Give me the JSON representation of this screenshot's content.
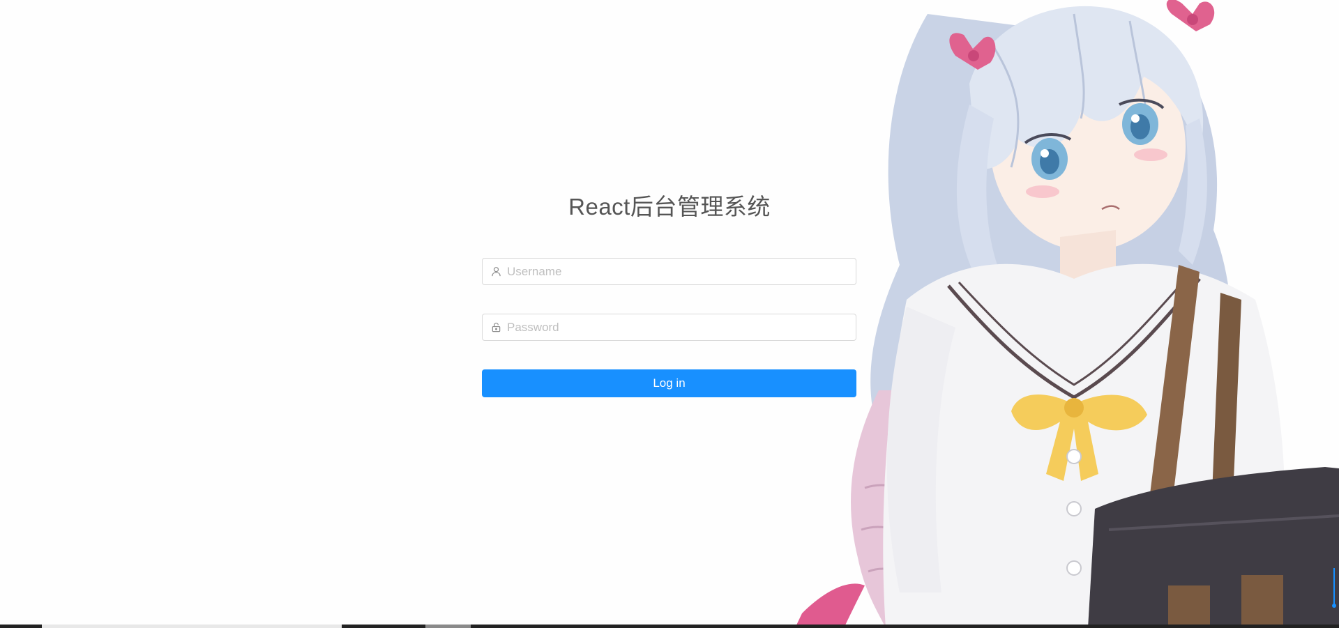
{
  "login": {
    "title": "React后台管理系统",
    "username": {
      "placeholder": "Username",
      "value": ""
    },
    "password": {
      "placeholder": "Password",
      "value": ""
    },
    "submit_label": "Log in"
  },
  "icons": {
    "username_prefix": "user-icon",
    "password_prefix": "lock-icon"
  },
  "colors": {
    "primary": "#1890ff",
    "title_text": "#555555",
    "placeholder": "#bfbfbf",
    "input_border": "#d9d9d9",
    "background": "#fefefe"
  }
}
